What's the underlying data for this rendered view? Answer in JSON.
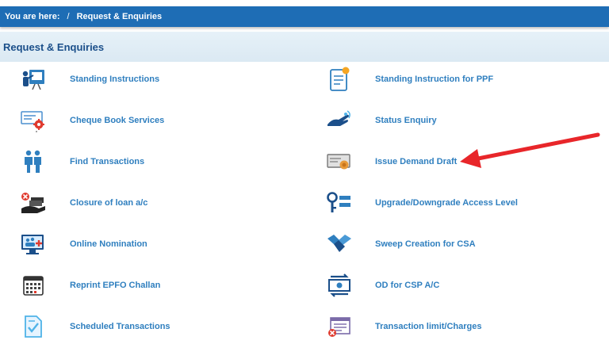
{
  "breadcrumb": {
    "prefix": "You are here:",
    "separator": "/",
    "current": "Request & Enquiries"
  },
  "section": {
    "title": "Request & Enquiries"
  },
  "items_left": [
    {
      "label": "Standing Instructions",
      "icon": "presenter-board-icon"
    },
    {
      "label": "Cheque Book Services",
      "icon": "cheque-gear-icon"
    },
    {
      "label": "Find Transactions",
      "icon": "people-search-icon"
    },
    {
      "label": "Closure of loan a/c",
      "icon": "hand-cash-close-icon"
    },
    {
      "label": "Online Nomination",
      "icon": "monitor-group-icon"
    },
    {
      "label": "Reprint EPFO Challan",
      "icon": "calendar-icon"
    },
    {
      "label": "Scheduled Transactions",
      "icon": "document-check-icon"
    }
  ],
  "items_right": [
    {
      "label": "Standing Instruction for PPF",
      "icon": "document-badge-icon"
    },
    {
      "label": "Status Enquiry",
      "icon": "hand-touch-icon"
    },
    {
      "label": "Issue Demand Draft",
      "icon": "demand-draft-icon"
    },
    {
      "label": "Upgrade/Downgrade Access Level",
      "icon": "key-levels-icon"
    },
    {
      "label": "Sweep Creation for CSA",
      "icon": "handshake-icon"
    },
    {
      "label": "OD for CSP A/C",
      "icon": "cash-transfer-icon"
    },
    {
      "label": "Transaction limit/Charges",
      "icon": "form-cancel-icon"
    }
  ],
  "colors": {
    "breadcrumb_bg": "#1e6db5",
    "header_bg": "#dbe9f3",
    "header_text": "#1b4f8a",
    "link_text": "#2f7fbf",
    "annotation_arrow": "#e8262a"
  }
}
